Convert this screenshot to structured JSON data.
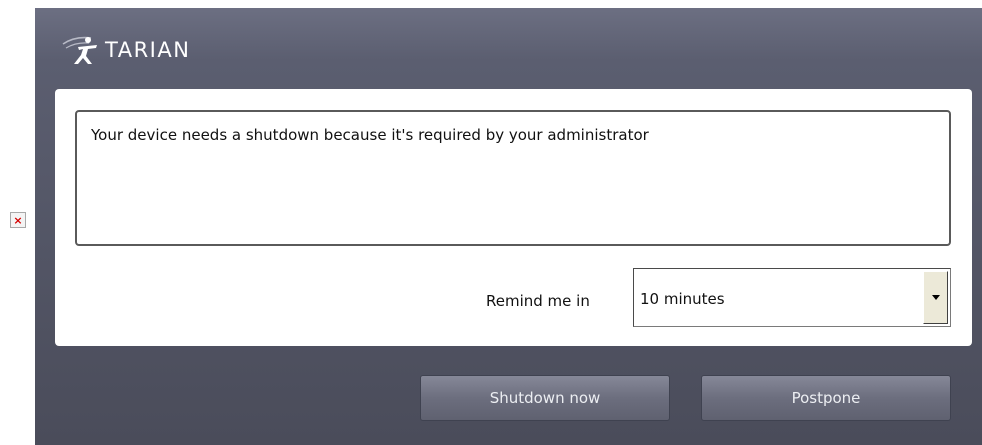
{
  "broken_image": {
    "glyph": "×"
  },
  "brand": {
    "name": "TARIAN"
  },
  "message": {
    "text": "Your device needs a shutdown because it's required by your administrator"
  },
  "remind": {
    "label": "Remind me in",
    "selected": "10 minutes"
  },
  "buttons": {
    "shutdown_now": "Shutdown now",
    "postpone": "Postpone"
  },
  "colors": {
    "dialog_background": "#5b5e70",
    "panel_background": "#ffffff",
    "button_text": "#eceef2",
    "broken_image_x": "#d40000"
  }
}
